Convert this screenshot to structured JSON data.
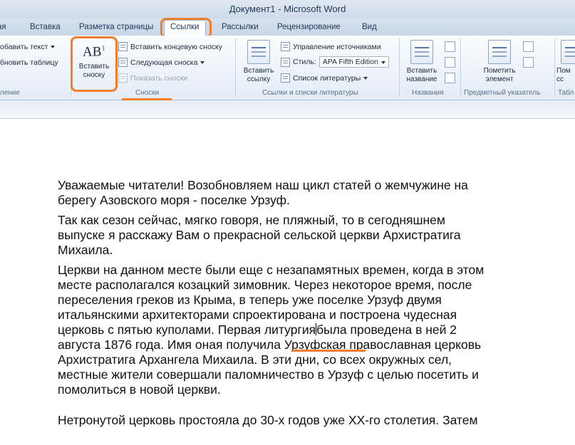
{
  "window": {
    "title": "Документ1 - Microsoft Word"
  },
  "tabs": [
    {
      "label": "ая"
    },
    {
      "label": "Вставка"
    },
    {
      "label": "Разметка страницы"
    },
    {
      "label": "Ссылки"
    },
    {
      "label": "Рассылки"
    },
    {
      "label": "Рецензирование"
    },
    {
      "label": "Вид"
    }
  ],
  "ribbon": {
    "toc_group": {
      "add_text": "обавить текст",
      "update_table": "бновить таблицу",
      "label": "ление"
    },
    "footnotes_group": {
      "insert_footnote_line1": "Вставить",
      "insert_footnote_line2": "сноску",
      "insert_endnote": "Вставить концевую сноску",
      "next_footnote": "Следующая сноска",
      "show_notes": "Показать сноски",
      "label": "Сноски",
      "ab_text": "AB",
      "ab_sup": "1"
    },
    "citations_group": {
      "insert_citation_line1": "Вставить",
      "insert_citation_line2": "ссылку",
      "manage_sources": "Управление источниками",
      "style_label": "Стиль:",
      "style_value": "APA Fifth Edition",
      "bibliography": "Список литературы",
      "label": "Ссылки и списки литературы"
    },
    "captions_group": {
      "insert_caption_line1": "Вставить",
      "insert_caption_line2": "название",
      "label": "Названия"
    },
    "index_group": {
      "mark_entry_line1": "Пометить",
      "mark_entry_line2": "элемент",
      "label": "Предметный указатель"
    },
    "toa_group": {
      "button_line1": "Пом",
      "button_line2": "сс",
      "label": "Табл"
    }
  },
  "document": {
    "paragraphs": [
      [
        "Уважаемые читатели! Возобновляем наш цикл статей о жемчужине на",
        "берегу Азовского моря - поселке Урзуф."
      ],
      [
        "Так как сезон сейчас, мягко говоря, не пляжный, то в сегодняшнем",
        "выпуске я расскажу Вам о прекрасной сельской церкви Архистратига",
        "Михаила."
      ],
      [
        "Церкви на данном месте были еще с незапамятных времен, когда в этом",
        "месте располагался козацкий зимовник. Через некоторое время, после",
        "переселения греков из Крыма, в теперь уже поселке Урзуф двумя",
        "итальянскими архитекторами спроектирована и построена чудесная"
      ],
      [
        "августа 1876 года. Имя оная получила Урзуфская православная церковь",
        "Архистратига Архангела Михаила. В эти дни, со всех окружных сел,",
        "местные жители совершали паломничество в Урзуф с целью посетить и",
        "помолиться в новой церкви."
      ],
      [
        "Нетронутой церковь простояла до 30-х годов уже XX-го столетия. Затем"
      ]
    ],
    "cursor_line": {
      "before": "церковь с пятью куполами. Первая ",
      "word": "литургия",
      "after": "была проведена в ней 2"
    }
  }
}
